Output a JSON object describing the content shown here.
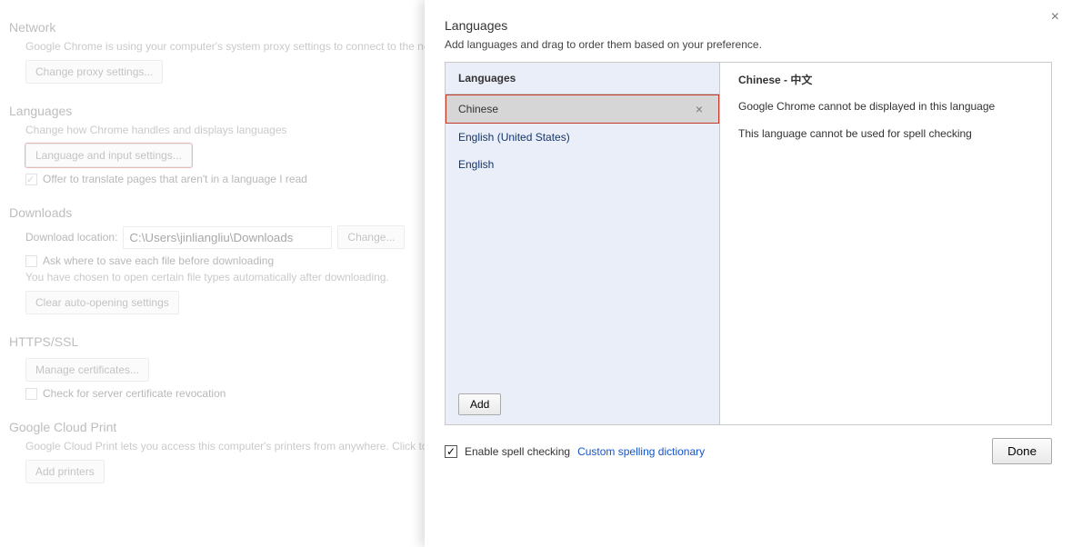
{
  "bg": {
    "network": {
      "title": "Network",
      "desc": "Google Chrome is using your computer's system proxy settings to connect to the network.",
      "change_proxy_btn": "Change proxy settings..."
    },
    "languages": {
      "title": "Languages",
      "desc": "Change how Chrome handles and displays languages",
      "lang_input_btn": "Language and input settings...",
      "translate_chk": "Offer to translate pages that aren't in a language I read"
    },
    "downloads": {
      "title": "Downloads",
      "location_label": "Download location:",
      "location_value": "C:\\Users\\jinliangliu\\Downloads",
      "change_btn": "Change...",
      "ask_chk": "Ask where to save each file before downloading",
      "auto_desc": "You have chosen to open certain file types automatically after downloading.",
      "clear_auto_btn": "Clear auto-opening settings"
    },
    "https": {
      "title": "HTTPS/SSL",
      "manage_btn": "Manage certificates...",
      "revoke_chk": "Check for server certificate revocation"
    },
    "cloud": {
      "title": "Google Cloud Print",
      "desc": "Google Cloud Print lets you access this computer's printers from anywhere. Click to enable.",
      "add_btn": "Add printers"
    }
  },
  "modal": {
    "title": "Languages",
    "subtitle": "Add languages and drag to order them based on your preference.",
    "col_head": "Languages",
    "langs": [
      {
        "name": "Chinese",
        "selected": true
      },
      {
        "name": "English (United States)",
        "selected": false
      },
      {
        "name": "English",
        "selected": false
      }
    ],
    "add_btn": "Add",
    "detail": {
      "title": "Chinese - 中文",
      "note1": "Google Chrome cannot be displayed in this language",
      "note2": "This language cannot be used for spell checking"
    },
    "foot": {
      "spell_label": "Enable spell checking",
      "custom_link": "Custom spelling dictionary",
      "done": "Done"
    }
  }
}
